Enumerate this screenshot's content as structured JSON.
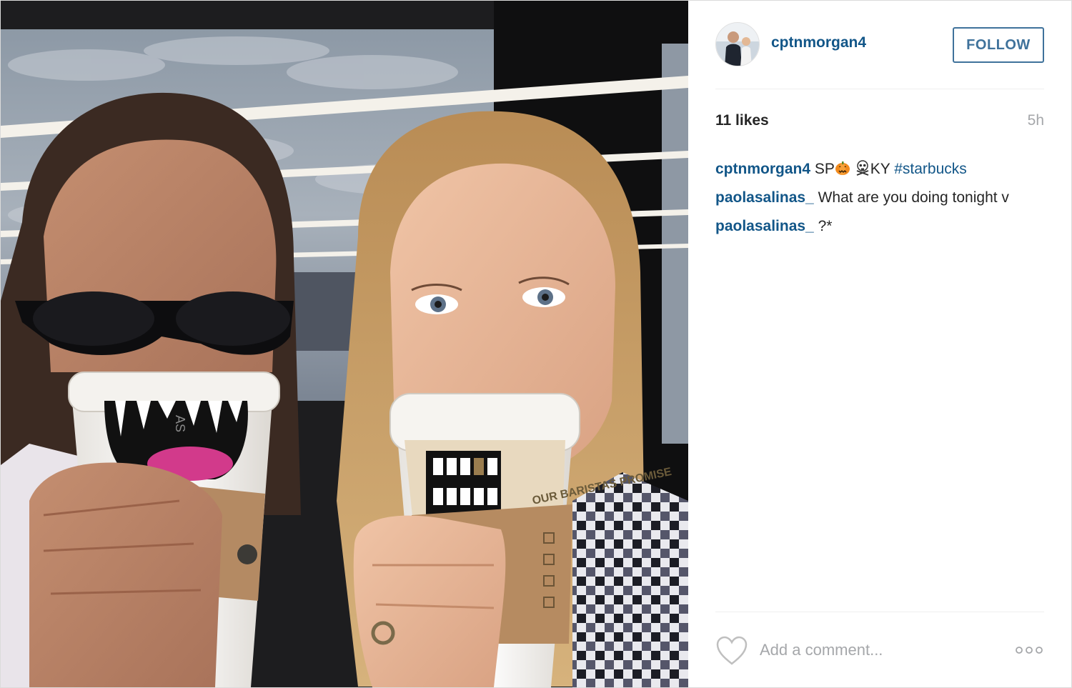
{
  "post": {
    "username": "cptnmorgan4",
    "follow_label": "FOLLOW",
    "likes": "11 likes",
    "time": "5h",
    "comments": [
      {
        "user": "cptnmorgan4",
        "parts": [
          "SP",
          "KY",
          "#starbucks"
        ],
        "emojis": [
          "pumpkin-icon",
          "skull-crossbones-icon"
        ]
      },
      {
        "user": "paolasalinas_",
        "text": "What are you doing tonight v"
      },
      {
        "user": "paolasalinas_",
        "text": "?*"
      }
    ],
    "add_comment_placeholder": "Add a comment...",
    "photo": {
      "cup_text_left": "AS",
      "cup_text_right": "OUR BARISTAS PROMISE"
    }
  },
  "colors": {
    "link": "#125688",
    "follow": "#3f729b",
    "muted": "#a5a7aa"
  }
}
